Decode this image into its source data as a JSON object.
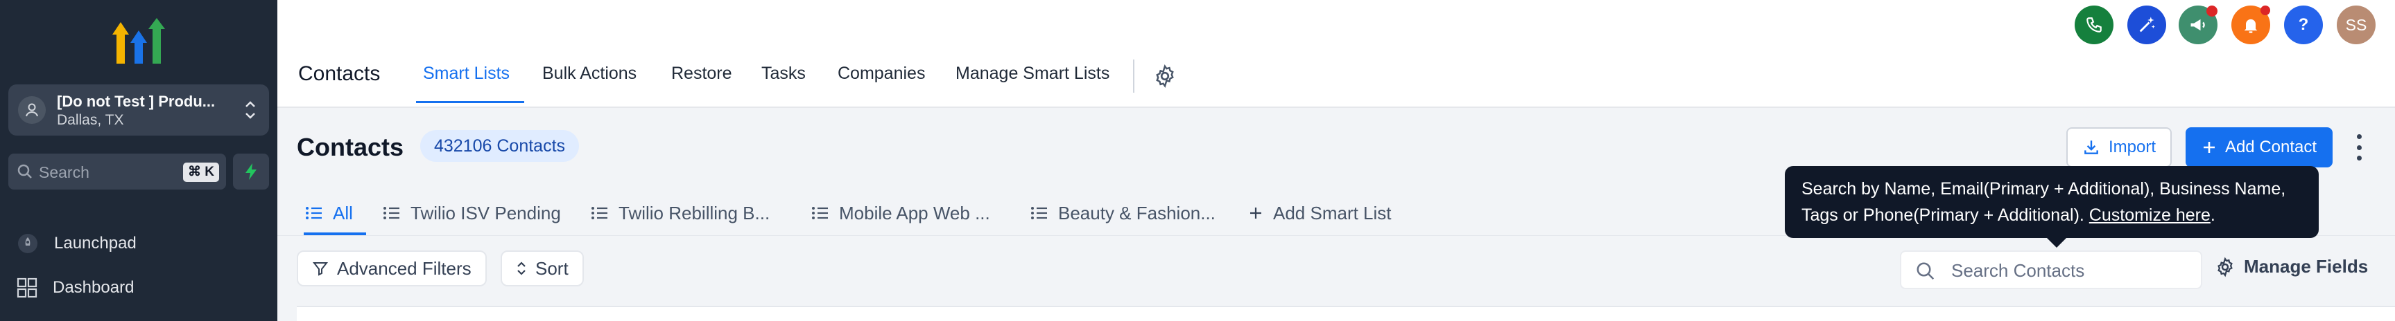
{
  "sidebar": {
    "account": {
      "name": "[Do not Test ] Produ...",
      "location": "Dallas, TX"
    },
    "search": {
      "placeholder": "Search",
      "shortcut": "⌘ K"
    },
    "items": [
      {
        "label": "Launchpad",
        "icon": "launchpad-icon"
      },
      {
        "label": "Dashboard",
        "icon": "dashboard-grid-icon"
      }
    ]
  },
  "header": {
    "actions": [
      {
        "name": "phone-button",
        "color": "#15803d"
      },
      {
        "name": "magic-button",
        "color": "#1d4ed8"
      },
      {
        "name": "announcements-button",
        "color": "#3f8f6e",
        "badge_color": "#dc2626"
      },
      {
        "name": "notifications-button",
        "color": "#f97316",
        "badge_color": "#dc2626"
      },
      {
        "name": "help-button",
        "color": "#2563eb",
        "label": "?"
      },
      {
        "name": "user-avatar",
        "color": "#b98c73",
        "label": "SS"
      }
    ]
  },
  "tabs": {
    "title": "Contacts",
    "items": [
      "Smart Lists",
      "Bulk Actions",
      "Restore",
      "Tasks",
      "Companies",
      "Manage Smart Lists"
    ],
    "active_index": 0
  },
  "main": {
    "title": "Contacts",
    "count_badge": "432106 Contacts",
    "import_label": "Import",
    "add_label": "Add Contact",
    "smart_lists": [
      {
        "label": "All",
        "active": true
      },
      {
        "label": "Twilio ISV Pending"
      },
      {
        "label": "Twilio Rebilling B..."
      },
      {
        "label": "Mobile App Web ..."
      },
      {
        "label": "Beauty & Fashion..."
      }
    ],
    "add_smart_list": "Add Smart List",
    "filters_label": "Advanced Filters",
    "sort_label": "Sort",
    "search_placeholder": "Search Contacts",
    "manage_fields_label": "Manage Fields"
  },
  "tooltip": {
    "line1": "Search by Name, Email(Primary + Additional), Business Name,",
    "line2_prefix": "Tags or Phone(Primary + Additional). ",
    "link": "Customize here",
    "line2_suffix": "."
  },
  "colors": {
    "accent": "#1570ef",
    "sidebar_bg": "#1f2937",
    "tooltip_bg": "#101828"
  }
}
